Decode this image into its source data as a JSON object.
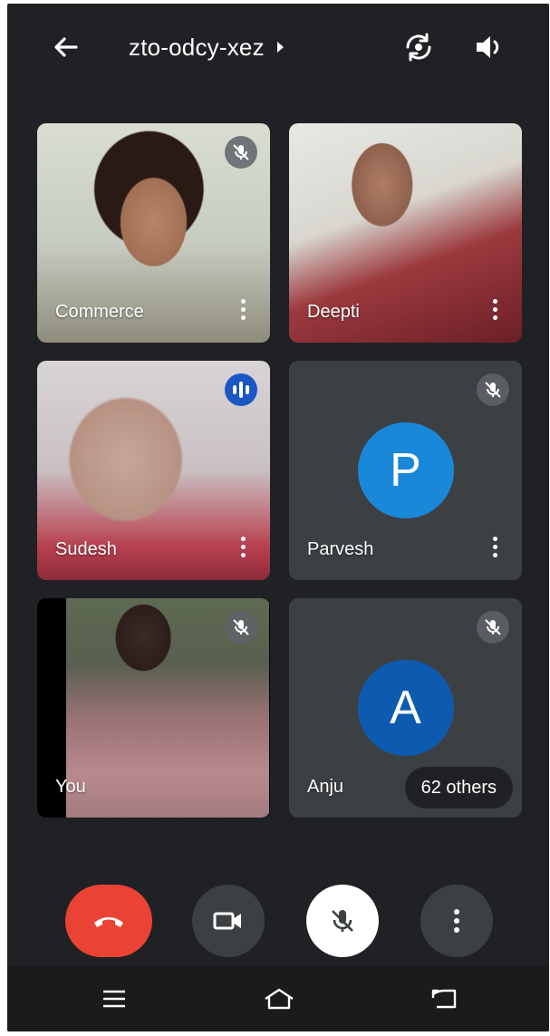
{
  "header": {
    "meeting_code": "zto-odcy-xez",
    "icons": {
      "back": "back-arrow-icon",
      "caret": "caret-right-icon",
      "switch_camera": "switch-camera-icon",
      "speaker": "speaker-icon"
    }
  },
  "participants": [
    {
      "name": "Commerce",
      "muted": true,
      "speaking": false,
      "video": true
    },
    {
      "name": "Deepti",
      "muted": false,
      "speaking": false,
      "video": true
    },
    {
      "name": "Sudesh",
      "muted": false,
      "speaking": true,
      "video": true
    },
    {
      "name": "Parvesh",
      "muted": true,
      "speaking": false,
      "video": false,
      "avatar_letter": "P",
      "avatar_color": "#1a88d8"
    },
    {
      "name": "You",
      "muted": true,
      "speaking": false,
      "video": true
    },
    {
      "name": "Anju",
      "muted": true,
      "speaking": false,
      "video": false,
      "avatar_letter": "A",
      "avatar_color": "#0d5bb0"
    }
  ],
  "others_chip": "62 others",
  "controls": {
    "end_call": {
      "icon": "end-call-icon",
      "color": "#ea4335"
    },
    "camera": {
      "icon": "camera-icon"
    },
    "microphone": {
      "icon": "mic-off-icon"
    },
    "more": {
      "icon": "more-vertical-icon"
    }
  },
  "nav_bar": {
    "menu": "menu-icon",
    "home": "home-icon",
    "back": "back-icon"
  },
  "colors": {
    "background": "#202124",
    "tile": "#3c4043",
    "speaking_badge": "#1a56c4"
  }
}
